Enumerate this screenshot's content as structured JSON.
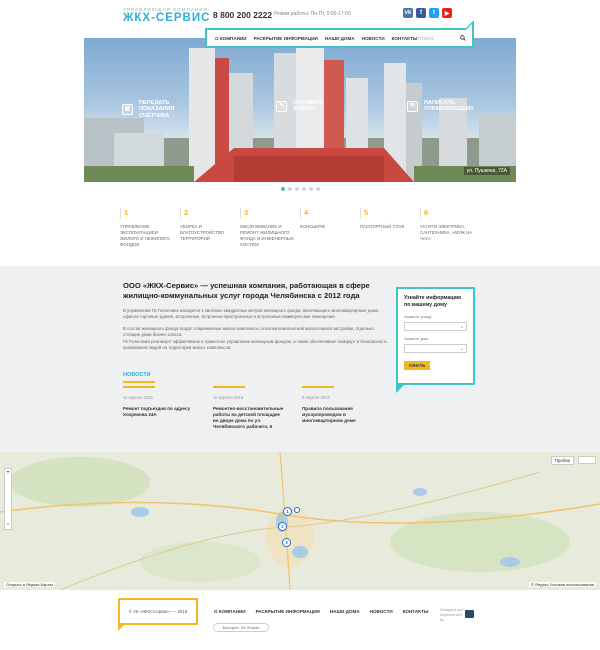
{
  "header": {
    "logo_sub": "Управляющая компания",
    "logo_main": "ЖКХ-СЕРВИС",
    "phone": "8 800 200 2222",
    "worktime": "Режим работы: Пн-Пт, 9:00-17:00",
    "socials": [
      {
        "name": "vk-icon",
        "label": "vk",
        "color": "#4a76a8"
      },
      {
        "name": "facebook-icon",
        "label": "f",
        "color": "#3b5998"
      },
      {
        "name": "twitter-icon",
        "label": "t",
        "color": "#1da1f2"
      },
      {
        "name": "youtube-icon",
        "label": "▶",
        "color": "#e62117"
      }
    ]
  },
  "nav": {
    "items": [
      "О компании",
      "Раскрытие информации",
      "Наши дома",
      "Новости",
      "Контакты"
    ],
    "search_placeholder": "Поиск"
  },
  "hero": {
    "actions": [
      {
        "label": "Передать показания счётчика",
        "icon": "meter-icon"
      },
      {
        "label": "Оставить заявку",
        "icon": "request-icon"
      },
      {
        "label": "Написать управляющему",
        "icon": "message-icon"
      }
    ],
    "caption": "ул. Пушкина, 72А",
    "slides": 6,
    "active_slide": 1
  },
  "services": [
    {
      "num": "1",
      "text": "Управление эксплуатацией жилого и нежилого фондов"
    },
    {
      "num": "2",
      "text": "Уборка и благоустройство территорий"
    },
    {
      "num": "3",
      "text": "Обслуживание и ремонт жилищного фонда и инженерных систем"
    },
    {
      "num": "4",
      "text": "Консьерж"
    },
    {
      "num": "5",
      "text": "Паспортный стол"
    },
    {
      "num": "6",
      "text": "Услуги электрика, сантехника, «муж на час»"
    }
  ],
  "about": {
    "title": "ООО «ЖКХ-Сервис» — успешная компания, работающая в сфере жилищно-коммунальных услуг города Челябинска с 2012 года",
    "paragraphs": [
      "В управлении ГК Голоплика находится 1 миллион квадратных метров жилищного фонда, включающего многоквартирные дома, офисно-торговые здания, встроенные, встроенно-пристроенные и встроенные коммерческие помещения.",
      "В состав жилищного фонда входят современные жилые комплексы, поселки комплексной малоэтажной застройки, отдельно стоящие дома бизнес-класса.",
      "ГК Голоплика реализует эффективное и грамотное управление жилищным фондом, а также обеспечивает комфорт и безопасность проживания людей на территории жилых комплексов."
    ]
  },
  "news": {
    "heading": "Новости",
    "items": [
      {
        "date": "11 апреля 2016",
        "title": "Ремонт подъездов по адресу Хохрякова 24А"
      },
      {
        "date": "10 апреля 2016",
        "title": "Ремонтно-восстановительные работы на детской площадке во дворе дома по ул. Челябинского рабочего, 6"
      },
      {
        "date": "9 апреля 2016",
        "title": "Правила пользования мусоропроводом в многоквартирном доме"
      }
    ]
  },
  "form": {
    "title": "Узнайте информацию по вашему дому",
    "street_label": "Укажите улицу:",
    "street_value": "",
    "house_label": "Укажите дом:",
    "house_value": "",
    "button": "Узнать"
  },
  "map": {
    "traffic": "Пробки",
    "markers": [
      "1",
      "2",
      "3",
      "3"
    ],
    "bottom_left": "Открыть в Яндекс.Картах",
    "bottom_right": "© Яндекс  Условия использования"
  },
  "footer": {
    "copyright": "© УК «ЖКХ-Сервис» — 2016",
    "nav": [
      "О компании",
      "Раскрытие информации",
      "Наши дома",
      "Новости",
      "Контакты"
    ],
    "search_button": "Быстрее: УК Лизинг",
    "developer": "Designed and implemented by"
  }
}
